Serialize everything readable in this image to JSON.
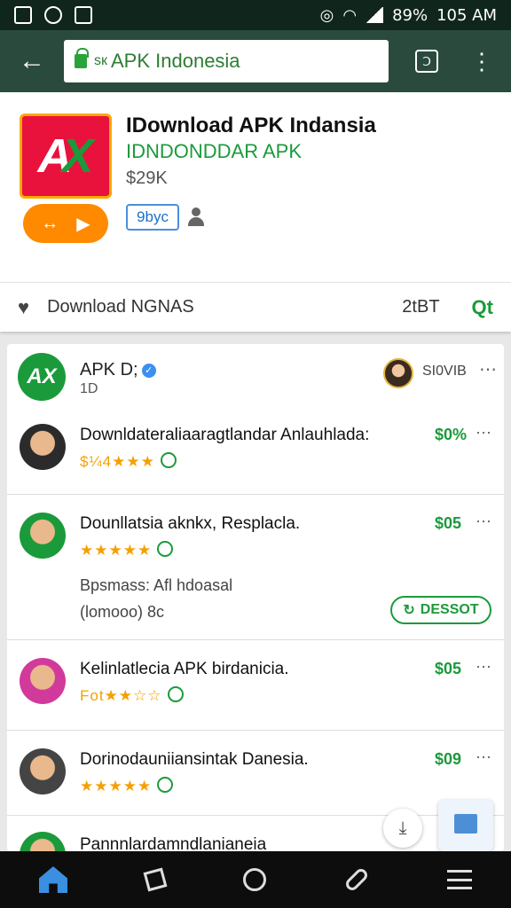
{
  "status_bar": {
    "battery": "89%",
    "time": "105 AM"
  },
  "toolbar": {
    "url_text": "APK Indonesia",
    "url_prefix": "ѕк"
  },
  "app": {
    "title": "IDownload APK Indansia",
    "developer": "IDNDONDDAR APK",
    "price": "$29K",
    "tag": "9byc"
  },
  "download_bar": {
    "label": "Download NGNAS",
    "count": "2tBT",
    "search_label": "Qt"
  },
  "list_header": {
    "name": "APK D;",
    "sub": "1D",
    "count": "SI0VIB"
  },
  "reviews": [
    {
      "title": "Downldateraliaaragtlandar Anlauhlada:",
      "price": "$0%",
      "stars_text": "$¼4★★★"
    },
    {
      "title": "Dounllatsia aknkx, Resplacla.",
      "price": "$05",
      "stars_text": "★★★★★",
      "extra1": "Bpsmass: Afl hdoasal",
      "extra2": "(lomooo) 8c",
      "button": "DESSOT"
    },
    {
      "title": "Kelinlatlecia APK birdanicia.",
      "price": "$05",
      "stars_text": "Fot★★☆☆"
    },
    {
      "title": "Dorinodauniiansintak Danesia.",
      "price": "$09",
      "stars_text": "★★★★★"
    },
    {
      "title": "Pannnlardamndlanianeia"
    }
  ],
  "colors": {
    "toolbar": "#2a4a3e",
    "accent_green": "#1b9a3b",
    "brand_orange": "#ff8a00",
    "brand_red": "#e8123c"
  }
}
